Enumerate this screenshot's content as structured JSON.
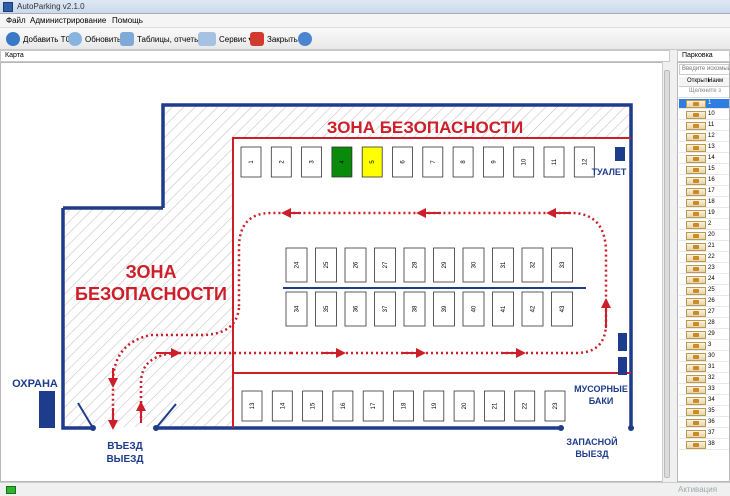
{
  "window": {
    "title": "AutoParking v2.1.0"
  },
  "menu": [
    "Файл",
    "Администрирование",
    "Помощь"
  ],
  "toolbar": {
    "add": "Добавить ТС",
    "refresh": "Обновить",
    "tables": "Таблицы, отчеты",
    "service": "Сервис",
    "close": "Закрыть"
  },
  "panels": {
    "map": "Карта",
    "parking": "Парковка"
  },
  "sidebar": {
    "search_placeholder": "Введите искомый",
    "col_open": "Открыть",
    "col_name": "Наим",
    "filter_hint": "Щелкните з",
    "rows": [
      "1",
      "10",
      "11",
      "12",
      "13",
      "14",
      "15",
      "16",
      "17",
      "18",
      "19",
      "2",
      "20",
      "21",
      "22",
      "23",
      "24",
      "25",
      "26",
      "27",
      "28",
      "29",
      "3",
      "30",
      "31",
      "32",
      "33",
      "34",
      "35",
      "36",
      "37",
      "38"
    ]
  },
  "map": {
    "zone1": "ЗОНА БЕЗОПАСНОСТИ",
    "zone2_line1": "ЗОНА",
    "zone2_line2": "БЕЗОПАСНОСТИ",
    "toilet": "ТУАЛЕТ",
    "guard": "ОХРАНА",
    "entry_line1": "ВЪЕЗД",
    "entry_line2": "ВЫЕЗД",
    "trash_line1": "МУСОРНЫЕ",
    "trash_line2": "БАКИ",
    "spare_line1": "ЗАПАСНОЙ",
    "spare_line2": "ВЫЕЗД",
    "spots_top": [
      "1",
      "2",
      "3",
      "4",
      "5",
      "6",
      "7",
      "8",
      "9",
      "10",
      "11",
      "12"
    ],
    "spots_bottom": [
      "13",
      "14",
      "15",
      "16",
      "17",
      "18",
      "19",
      "20",
      "21",
      "22",
      "23"
    ],
    "spots_mid_upper": [
      "24",
      "25",
      "26",
      "27",
      "28",
      "29",
      "30",
      "31",
      "32",
      "33"
    ],
    "spots_mid_lower": [
      "34",
      "35",
      "36",
      "37",
      "38",
      "39",
      "40",
      "41",
      "42",
      "43"
    ],
    "occupied_color": "#0a8a0a",
    "reserved_color": "#ffff00"
  },
  "status": {
    "activation": "Активация"
  },
  "colors": {
    "wall": "#1e3c8c",
    "red": "#cc1f2a",
    "select": "#2e7de1"
  }
}
